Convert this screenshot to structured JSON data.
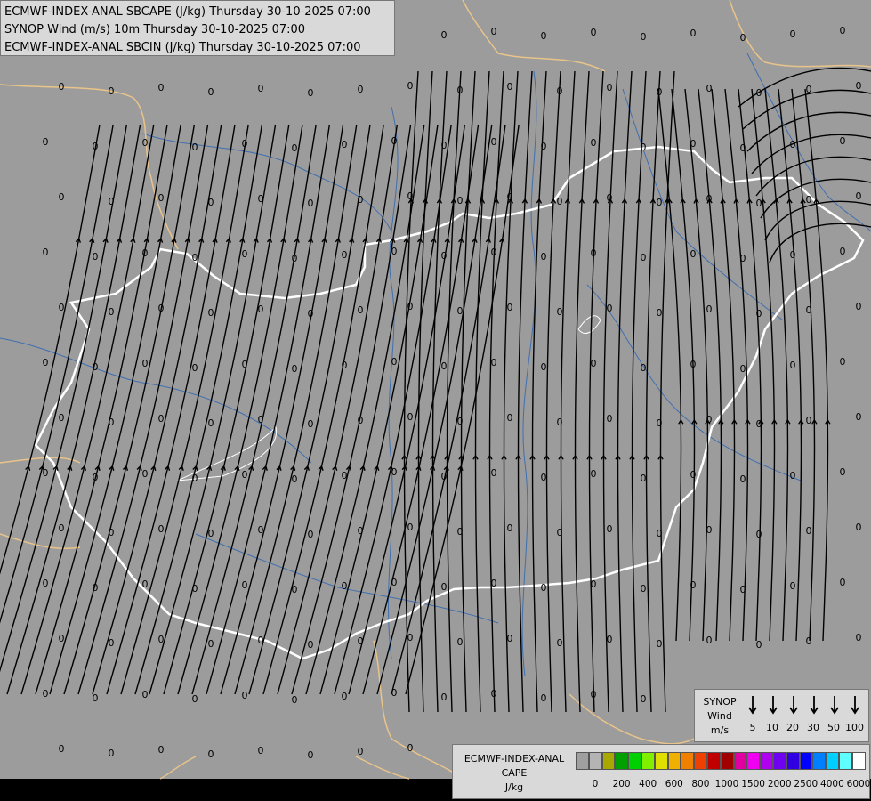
{
  "title": {
    "line1": "ECMWF-INDEX-ANAL SBCAPE (J/kg) Thursday 30-10-2025 07:00",
    "line2": "SYNOP Wind (m/s) 10m Thursday 30-10-2025 07:00",
    "line3": "ECMWF-INDEX-ANAL SBCIN (J/kg) Thursday 30-10-2025 07:00"
  },
  "map": {
    "background_color": "#9c9c9c",
    "field_value": "0",
    "border_color": "#ffffff",
    "outer_border_color": "#e8c48a",
    "river_color": "#3f6fb0",
    "streamline_color": "#000000"
  },
  "wind_legend": {
    "label_line1": "SYNOP",
    "label_line2": "Wind",
    "label_line3": "m/s",
    "values": [
      "5",
      "10",
      "20",
      "30",
      "50",
      "100"
    ]
  },
  "cape_legend": {
    "label_line1": "ECMWF-INDEX-ANAL",
    "label_line2": "CAPE",
    "label_line3": "J/kg",
    "colors": [
      "#a0a0a0",
      "#b4b4b4",
      "#a8a800",
      "#00a000",
      "#00d000",
      "#80f000",
      "#e0e000",
      "#f0b000",
      "#f08000",
      "#f04000",
      "#c00000",
      "#a00000",
      "#e000a0",
      "#f000f0",
      "#b000f0",
      "#7000f0",
      "#3000e0",
      "#0000ff",
      "#0080ff",
      "#00d0ff",
      "#60ffff",
      "#ffffff"
    ],
    "tick_labels": [
      "0",
      "200",
      "400",
      "600",
      "800",
      "1000",
      "1500",
      "2000",
      "2500",
      "4000",
      "6000"
    ]
  }
}
